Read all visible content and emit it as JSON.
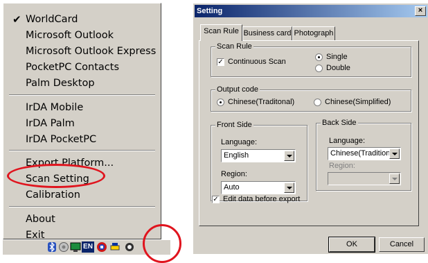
{
  "menu": {
    "checked_item": "WorldCard",
    "checkmark": "✔",
    "group1": [
      "Microsoft Outlook",
      "Microsoft Outlook Express",
      "PocketPC Contacts",
      "Palm Desktop"
    ],
    "group2": [
      "IrDA Mobile",
      "IrDA Palm",
      "IrDA PocketPC"
    ],
    "group3": [
      "Export Platform...",
      "Scan Setting",
      "Calibration"
    ],
    "group4": [
      "About",
      "Exit"
    ],
    "highlighted": "Scan Setting"
  },
  "taskbar": {
    "tray_icons": [
      "bluetooth-icon",
      "network-icon",
      "display-icon",
      "language-indicator-icon",
      "worldcard-tray-icon",
      "printer-icon"
    ],
    "language_indicator": "EN"
  },
  "dialog": {
    "title": "Setting",
    "close_glyph": "×",
    "tabs": [
      "Scan Rule",
      "Business card",
      "Photograph"
    ],
    "active_tab": "Scan Rule",
    "scan_rule": {
      "label": "Scan Rule",
      "continuous_scan": {
        "label": "Continuous Scan",
        "checked": true
      },
      "mode_options": [
        {
          "label": "Single",
          "selected": true
        },
        {
          "label": "Double",
          "selected": false
        }
      ]
    },
    "output_code": {
      "label": "Output code",
      "options": [
        {
          "label": "Chinese(Traditonal)",
          "selected": true
        },
        {
          "label": "Chinese(Simplified)",
          "selected": false
        }
      ]
    },
    "front_side": {
      "label": "Front Side",
      "language_label": "Language:",
      "language_value": "English",
      "region_label": "Region:",
      "region_value": "Auto"
    },
    "back_side": {
      "label": "Back Side",
      "language_label": "Language:",
      "language_value": "Chinese(Traditional",
      "region_label": "Region:",
      "region_value": ""
    },
    "edit_before_export": {
      "label": "Edit data before export",
      "checked": true
    },
    "ok_label": "OK",
    "cancel_label": "Cancel"
  },
  "colors": {
    "face": "#d4d0c8",
    "title_start": "#0a246a",
    "title_end": "#a6caf0",
    "highlight_ring": "#e0141e"
  }
}
